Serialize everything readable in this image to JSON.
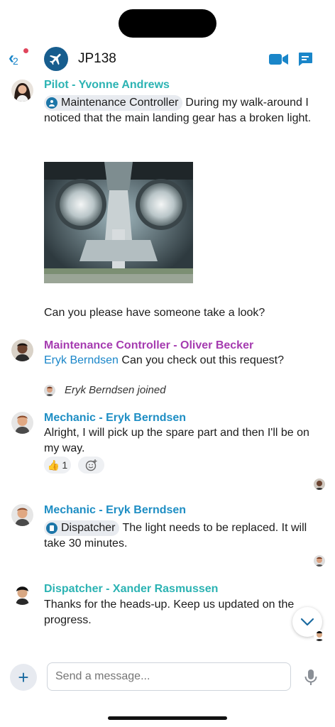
{
  "header": {
    "back_count": "2",
    "room_title": "JP138",
    "icons": {
      "back": "chevron-left-icon",
      "room": "airplane-icon",
      "video": "video-camera-icon",
      "threads": "chat-bubble-icon"
    }
  },
  "messages": [
    {
      "sender": "Pilot - Yvonne Andrews",
      "sender_color": "#2bb3b3",
      "chip": "Maintenance Controller",
      "text": "During my walk-around I noticed that the main landing gear has a broken light.",
      "image_caption": "landing-gear-photo",
      "text2": "Can you please have someone take a look?"
    },
    {
      "sender": "Maintenance Controller - Oliver Becker",
      "sender_color": "#a53bb0",
      "mention": "Eryk Berndsen",
      "text": "Can you check out this request?"
    },
    {
      "system": "Eryk Berndsen joined"
    },
    {
      "sender": "Mechanic - Eryk Berndsen",
      "sender_color": "#1e8ec4",
      "text": "Alright, I will pick up the spare part and then I'll be on my way.",
      "reaction_emoji": "👍",
      "reaction_count": "1"
    },
    {
      "sender": "Mechanic - Eryk Berndsen",
      "sender_color": "#1e8ec4",
      "chip": "Dispatcher",
      "text": "The light needs to be replaced. It will take 30 minutes."
    },
    {
      "sender": "Dispatcher - Xander Rasmussen",
      "sender_color": "#2bb3b3",
      "text": "Thanks for the heads-up. Keep us updated on the progress."
    }
  ],
  "composer": {
    "placeholder": "Send a message...",
    "icons": {
      "add": "plus-icon",
      "mic": "microphone-icon",
      "scroll": "chevron-down-icon"
    }
  },
  "colors": {
    "accent": "#1a86c9",
    "brand_dark": "#175d8e"
  }
}
